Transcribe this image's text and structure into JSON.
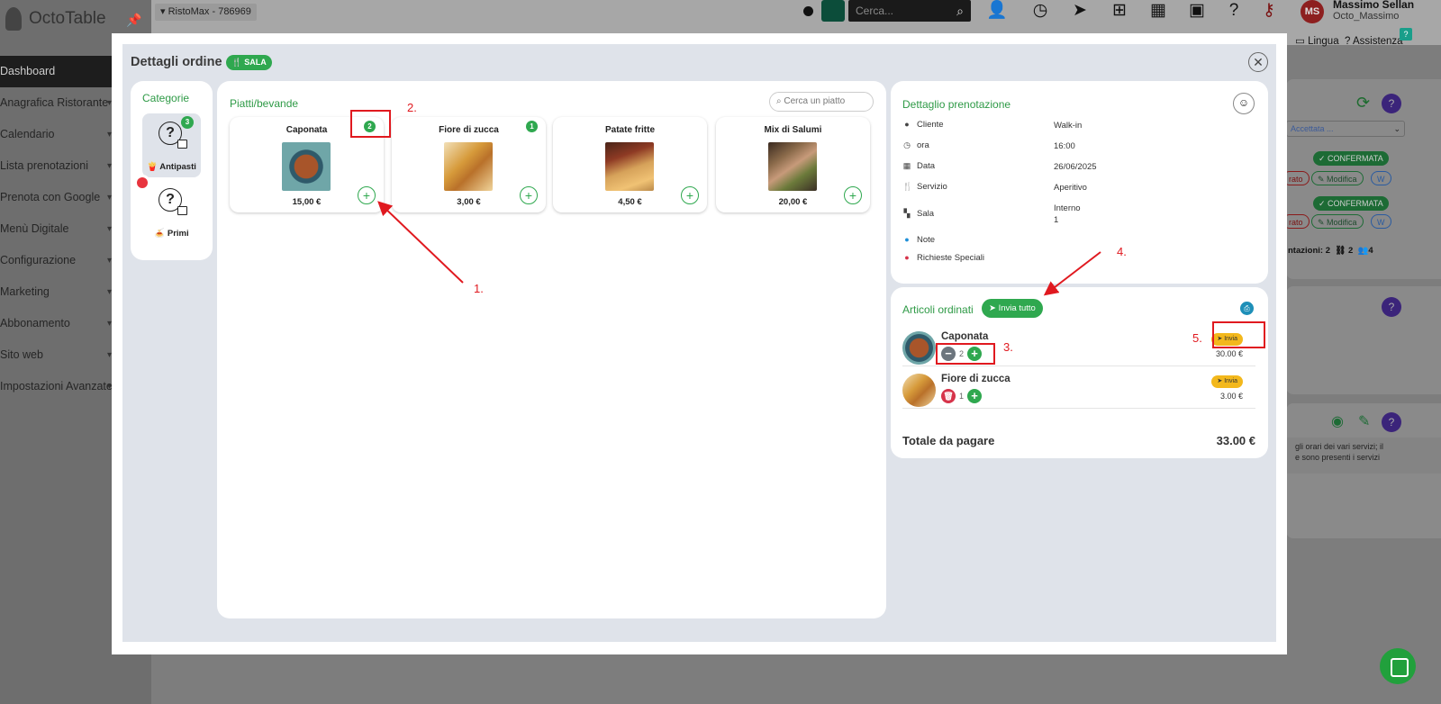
{
  "background": {
    "app_name": "OctoTable",
    "restaurant_selector": "RistoMax - 786969",
    "search_placeholder": "Cerca...",
    "user_initials": "MS",
    "user_name": "Massimo Sellan",
    "user_handle": "Octo_Massimo",
    "lingua": "Lingua",
    "assistenza": "Assistenza",
    "help_badge": "?",
    "sidebar_items": [
      "Dashboard",
      "Anagrafica Ristorante",
      "Calendario",
      "Lista prenotazioni",
      "Prenota con Google",
      "Menù Digitale",
      "Configurazione",
      "Marketing",
      "Abbonamento",
      "Sito web",
      "Impostazioni Avanzate"
    ],
    "right_cards": {
      "dropdown_text": "Accettata ...",
      "status_1": "CONFERMATA",
      "status_2": "CONFERMATA",
      "button_modifica_1": "Modifica",
      "button_modifica_2": "Modifica",
      "button_partial_1": "rato",
      "button_partial_2": "rato",
      "stats_text": "ntazioni: 2",
      "stats_tables": "2",
      "stats_people": "4",
      "note_text_1": "gli orari dei vari servizi; il",
      "note_text_2": "e sono presenti i servizi"
    }
  },
  "modal": {
    "title": "Dettagli ordine",
    "room_badge": "SALA",
    "categories": {
      "title": "Categorie",
      "items": [
        {
          "label": "Antipasti",
          "emoji": "🍟",
          "count": "3",
          "active": true
        },
        {
          "label": "Primi",
          "emoji": "🍝",
          "count": "",
          "active": false
        }
      ]
    },
    "dishes": {
      "title": "Piatti/bevande",
      "search_placeholder": "Cerca un piatto",
      "items": [
        {
          "name": "Caponata",
          "price": "15,00 €",
          "count": "2"
        },
        {
          "name": "Fiore di zucca",
          "price": "3,00 €",
          "count": "1"
        },
        {
          "name": "Patate fritte",
          "price": "4,50 €",
          "count": ""
        },
        {
          "name": "Mix di Salumi",
          "price": "20,00 €",
          "count": ""
        }
      ]
    },
    "booking_detail": {
      "title": "Dettaglio prenotazione",
      "rows": [
        {
          "label": "Cliente",
          "value": "Walk-in"
        },
        {
          "label": "ora",
          "value": "16:00"
        },
        {
          "label": "Data",
          "value": "26/06/2025"
        },
        {
          "label": "Servizio",
          "value": "Aperitivo"
        },
        {
          "label": "Sala",
          "value": "Interno",
          "value2": "1"
        },
        {
          "label": "Note",
          "value": ""
        },
        {
          "label": "Richieste Speciali",
          "value": ""
        }
      ]
    },
    "ordered_items": {
      "title": "Articoli ordinati",
      "send_all_label": "Invia tutto",
      "send_label": "Invia",
      "items": [
        {
          "name": "Caponata",
          "qty": "2",
          "price": "30.00 €"
        },
        {
          "name": "Fiore di zucca",
          "qty": "1",
          "price": "3.00 €"
        }
      ],
      "total_label": "Totale da pagare",
      "total_value": "33.00 €"
    }
  },
  "annotations": [
    "1.",
    "2.",
    "3.",
    "4.",
    "5."
  ],
  "colors": {
    "accent_green": "#2fa84f",
    "annotation_red": "#e0191f",
    "send_yellow": "#f3b81c"
  }
}
